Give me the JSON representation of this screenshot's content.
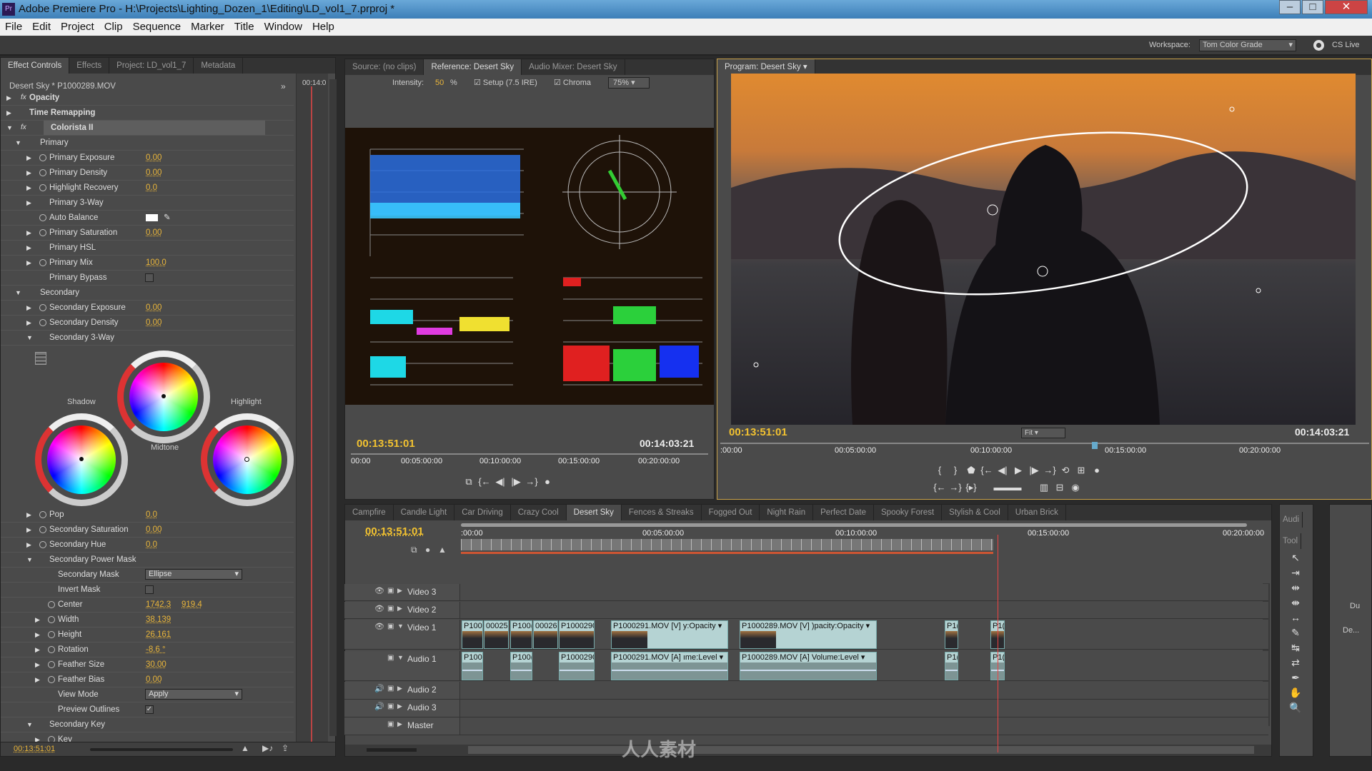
{
  "app": {
    "title": "Adobe Premiere Pro - H:\\Projects\\Lighting_Dozen_1\\Editing\\LD_vol1_7.prproj *",
    "logo": "Pr"
  },
  "menu": [
    "File",
    "Edit",
    "Project",
    "Clip",
    "Sequence",
    "Marker",
    "Title",
    "Window",
    "Help"
  ],
  "workspace": {
    "label": "Workspace:",
    "value": "Tom Color Grade",
    "cslive": "CS Live"
  },
  "left_panel": {
    "tabs": [
      "Effect Controls",
      "Effects",
      "Project: LD_vol1_7",
      "Metadata"
    ],
    "clip": "Desert Sky * P1000289.MOV",
    "mini_time": "00:14:0",
    "rows_top": [
      {
        "label": "Opacity",
        "arrow": "▶",
        "fx": true,
        "bold": true,
        "ind": 0
      },
      {
        "label": "Time Remapping",
        "arrow": "▶",
        "bold": true,
        "ind": 0
      },
      {
        "label": "Colorista II",
        "arrow": "▼",
        "fx": true,
        "bold": true,
        "ind": 0,
        "hl": true
      },
      {
        "label": "Primary",
        "arrow": "▼",
        "ind": 1
      },
      {
        "label": "Primary Exposure",
        "arrow": "▶",
        "sw": true,
        "value": "0.00",
        "ind": 2
      },
      {
        "label": "Primary Density",
        "arrow": "▶",
        "sw": true,
        "value": "0.00",
        "ind": 2
      },
      {
        "label": "Highlight Recovery",
        "arrow": "▶",
        "sw": true,
        "value": "0.0",
        "ind": 2
      },
      {
        "label": "Primary 3-Way",
        "arrow": "▶",
        "ind": 2
      },
      {
        "label": "Auto Balance",
        "sw": true,
        "swatch": true,
        "ind": 2
      },
      {
        "label": "Primary Saturation",
        "arrow": "▶",
        "sw": true,
        "value": "0.00",
        "ind": 2
      },
      {
        "label": "Primary HSL",
        "arrow": "▶",
        "ind": 2
      },
      {
        "label": "Primary Mix",
        "arrow": "▶",
        "sw": true,
        "value": "100.0",
        "ind": 2
      },
      {
        "label": "Primary Bypass",
        "check": "",
        "ind": 2
      },
      {
        "label": "Secondary",
        "arrow": "▼",
        "ind": 1
      },
      {
        "label": "Secondary Exposure",
        "arrow": "▶",
        "sw": true,
        "value": "0.00",
        "ind": 2
      },
      {
        "label": "Secondary Density",
        "arrow": "▶",
        "sw": true,
        "value": "0.00",
        "ind": 2
      },
      {
        "label": "Secondary 3-Way",
        "arrow": "▼",
        "ind": 2
      }
    ],
    "wheels": {
      "shadow": "Shadow",
      "midtone": "Midtone",
      "highlight": "Highlight"
    },
    "rows_bottom": [
      {
        "label": "Pop",
        "arrow": "▶",
        "sw": true,
        "value": "0.0",
        "ind": 2
      },
      {
        "label": "Secondary Saturation",
        "arrow": "▶",
        "sw": true,
        "value": "0.00",
        "ind": 2
      },
      {
        "label": "Secondary Hue",
        "arrow": "▶",
        "sw": true,
        "value": "0.0",
        "ind": 2
      },
      {
        "label": "Secondary Power Mask",
        "arrow": "▼",
        "ind": 2
      },
      {
        "label": "Secondary Mask",
        "dropdown": "Ellipse",
        "ind": 3
      },
      {
        "label": "Invert Mask",
        "check": "",
        "ind": 3
      },
      {
        "label": "Center",
        "sw": true,
        "value": "1742.3",
        "value2": "919.4",
        "ind": 3
      },
      {
        "label": "Width",
        "arrow": "▶",
        "sw": true,
        "value": "38.139",
        "ind": 3
      },
      {
        "label": "Height",
        "arrow": "▶",
        "sw": true,
        "value": "26.161",
        "ind": 3
      },
      {
        "label": "Rotation",
        "arrow": "▶",
        "sw": true,
        "value": "-8.6 °",
        "ind": 3
      },
      {
        "label": "Feather Size",
        "arrow": "▶",
        "sw": true,
        "value": "30.00",
        "ind": 3
      },
      {
        "label": "Feather Bias",
        "arrow": "▶",
        "sw": true,
        "value": "0.00",
        "ind": 3
      },
      {
        "label": "View Mode",
        "dropdown": "Apply",
        "ind": 3
      },
      {
        "label": "Preview Outlines",
        "check": "✓",
        "ind": 3
      },
      {
        "label": "Secondary Key",
        "arrow": "▼",
        "ind": 2
      },
      {
        "label": "Key",
        "arrow": "▶",
        "sw": true,
        "ind": 3
      }
    ],
    "timecode": "00:13:51:01"
  },
  "reference": {
    "tabs": [
      "Source: (no clips)",
      "Reference: Desert Sky",
      "Audio Mixer: Desert Sky"
    ],
    "intensity_label": "Intensity:",
    "intensity": "50",
    "pct": "%",
    "setup": "Setup (7.5 IRE)",
    "chroma": "Chroma",
    "zoom": "75%",
    "tc_left": "00:13:51:01",
    "tc_right": "00:14:03:21",
    "ruler": [
      "00:00",
      "00:05:00:00",
      "00:10:00:00",
      "00:15:00:00",
      "00:20:00:00"
    ]
  },
  "program": {
    "tab": "Program: Desert Sky",
    "fit": "Fit",
    "tc_left": "00:13:51:01",
    "tc_right": "00:14:03:21",
    "ruler": [
      ":00:00",
      "00:05:00:00",
      "00:10:00:00",
      "00:15:00:00",
      "00:20:00:00"
    ]
  },
  "timeline": {
    "tabs": [
      "Campfire",
      "Candle Light",
      "Car Driving",
      "Crazy Cool",
      "Desert Sky",
      "Fences & Streaks",
      "Fogged Out",
      "Night Rain",
      "Perfect Date",
      "Spooky Forest",
      "Stylish & Cool",
      "Urban Brick"
    ],
    "active_tab": "Desert Sky",
    "timecode": "00:13:51:01",
    "ruler": [
      ":00:00",
      "00:05:00:00",
      "00:10:00:00",
      "00:15:00:00",
      "00:20:00:00"
    ],
    "tracks": [
      "Video 3",
      "Video 2",
      "Video 1",
      "Audio 1",
      "Audio 2",
      "Audio 3",
      "Master"
    ],
    "video_clips": [
      "P100",
      "00025",
      "P100(",
      "00026",
      "P1000290",
      "P1000291.MOV [V]  y:Opacity ▾",
      "P1000289.MOV [V]  )pacity:Opacity ▾",
      "P1(",
      "P1("
    ],
    "audio_clips": [
      "P100",
      "P100(",
      "P1000290",
      "P1000291.MOV [A]  ıme:Level ▾",
      "P1000289.MOV [A]  Volume:Level ▾",
      "P1(",
      "P1("
    ]
  },
  "side": {
    "audio_tab": "Audi",
    "tools_tab": "Tool",
    "du": "Du",
    "de": "De..."
  },
  "watermark": "人人素材"
}
